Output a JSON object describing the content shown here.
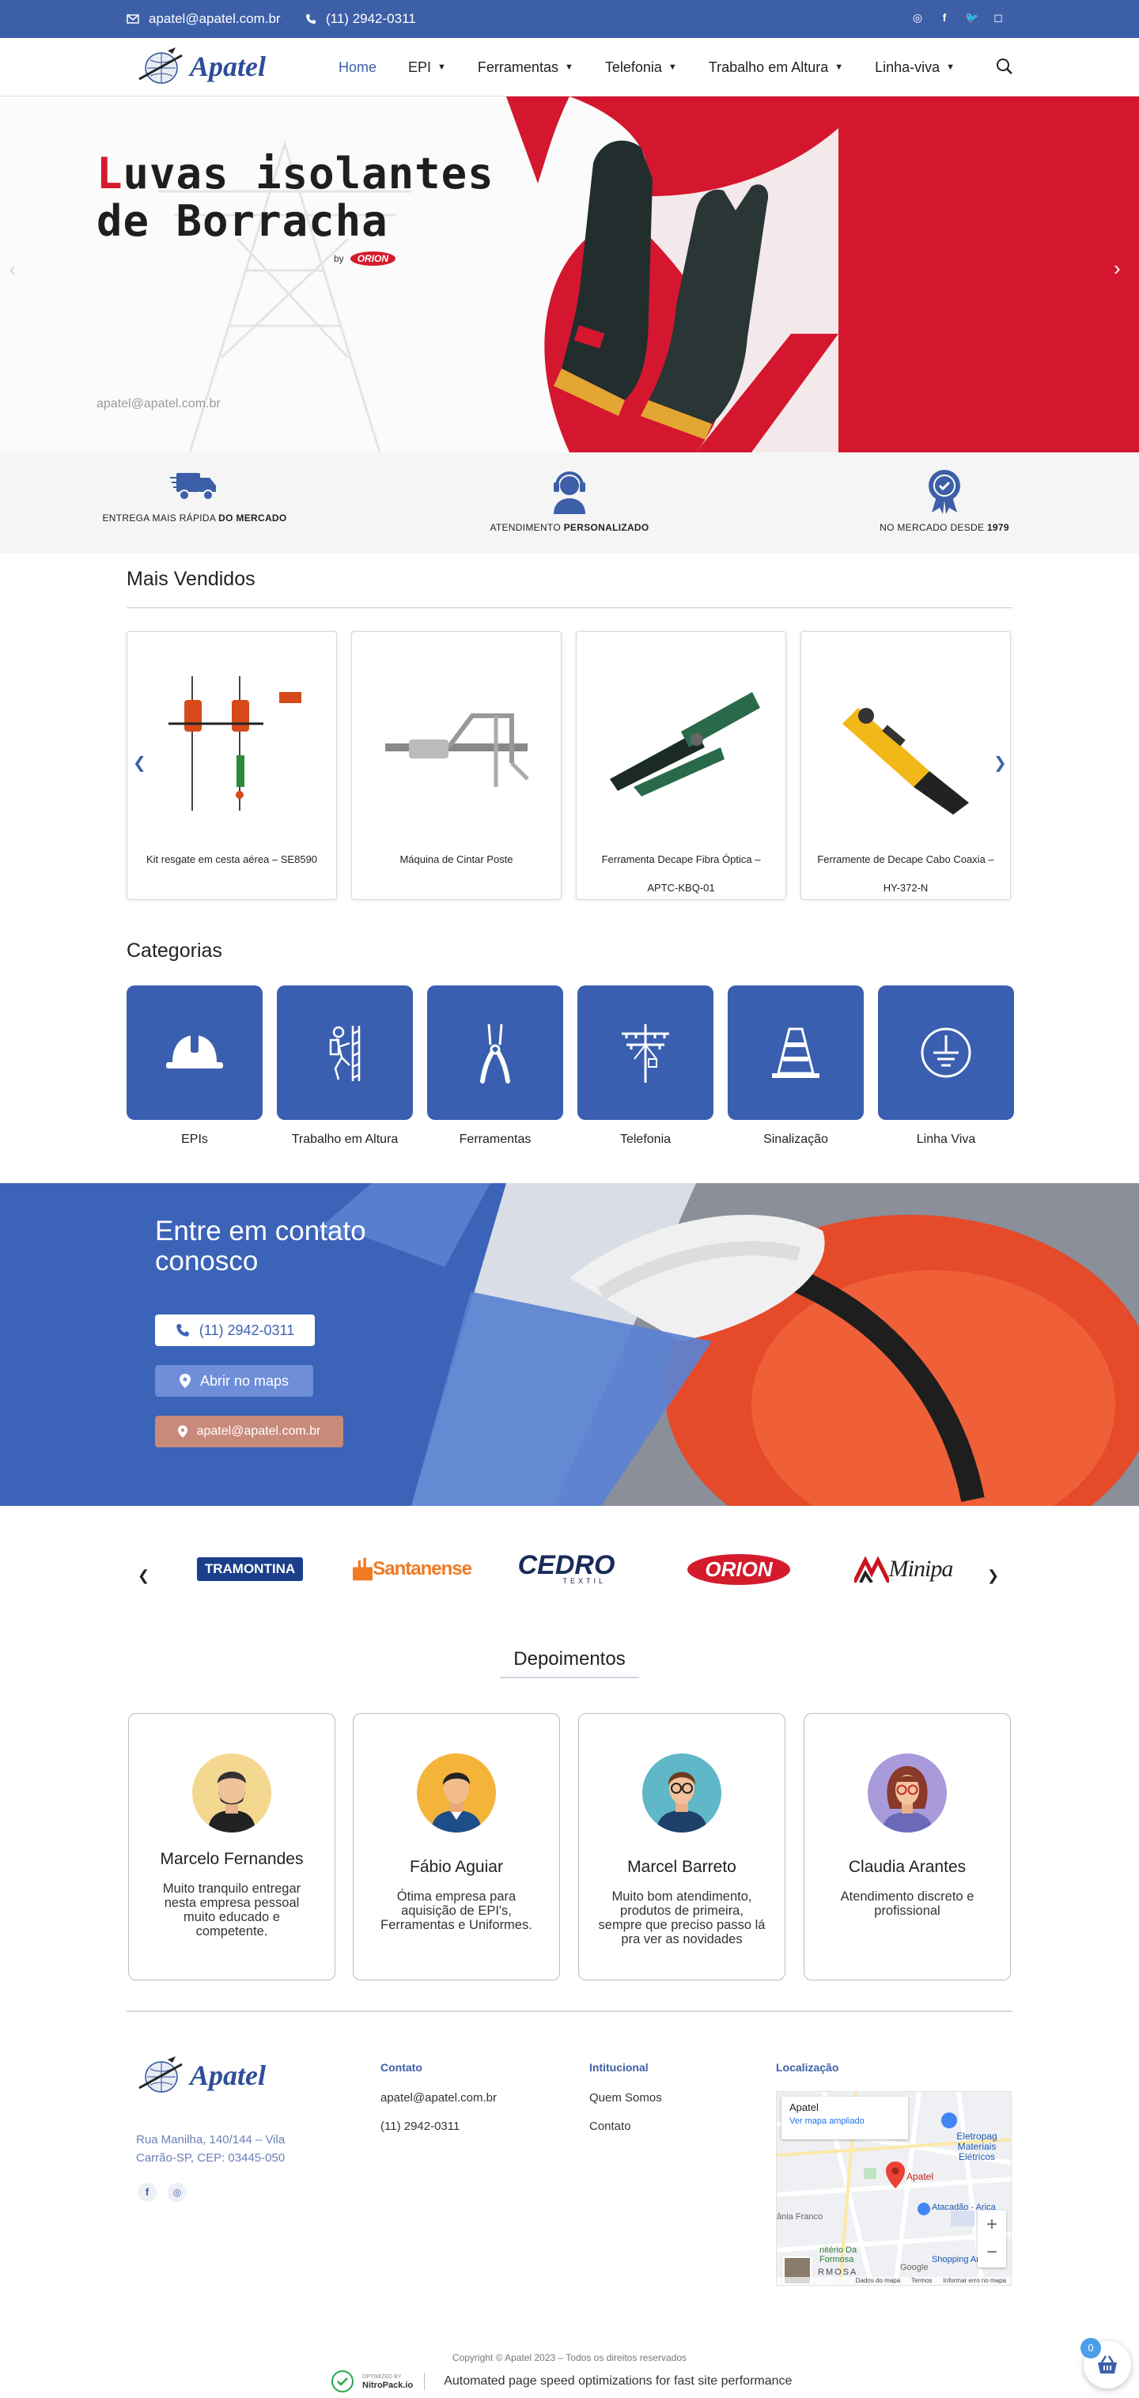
{
  "topbar": {
    "email": "apatel@apatel.com.br",
    "phone": "(11) 2942-0311",
    "social_icons": [
      "whatsapp-icon",
      "facebook-icon",
      "twitter-icon",
      "instagram-icon"
    ]
  },
  "brand": {
    "name": "Apatel",
    "color": "#3d5fa8"
  },
  "nav": {
    "items": [
      {
        "label": "Home",
        "active": true
      },
      {
        "label": "EPI"
      },
      {
        "label": "Ferramentas"
      },
      {
        "label": "Telefonia"
      },
      {
        "label": "Trabalho em Altura"
      },
      {
        "label": "Linha-viva"
      }
    ]
  },
  "hero": {
    "title_first": "L",
    "title_rest_line1": "uvas isolantes",
    "title_line2": "de Borracha",
    "by": "by",
    "by_brand": "ORION",
    "email": "apatel@apatel.com.br"
  },
  "features": [
    {
      "text_plain": "ENTREGA MAIS RÁPIDA ",
      "text_bold": "DO MERCADO"
    },
    {
      "text_plain": "ATENDIMENTO ",
      "text_bold": "PERSONALIZADO"
    },
    {
      "text_plain": "NO MERCADO DESDE ",
      "text_bold": "1979"
    }
  ],
  "bestsellers": {
    "title": "Mais Vendidos",
    "products": [
      {
        "name": "Kit resgate em cesta aérea – SE8590"
      },
      {
        "name": "Máquina de Cintar Poste"
      },
      {
        "name": "Ferramenta Decape Fibra Óptica –",
        "name2": "APTC-KBQ-01"
      },
      {
        "name": "Ferramente de Decape Cabo Coaxia –",
        "name2": "HY-372-N"
      }
    ]
  },
  "categories": {
    "title": "Categorias",
    "items": [
      {
        "label": "EPIs"
      },
      {
        "label": "Trabalho em Altura"
      },
      {
        "label": "Ferramentas"
      },
      {
        "label": "Telefonia"
      },
      {
        "label": "Sinalização"
      },
      {
        "label": "Linha Viva"
      }
    ]
  },
  "contact": {
    "title_line1": "Entre em contato",
    "title_line2": "conosco",
    "phone_btn": "(11) 2942-0311",
    "maps_btn": "Abrir no maps",
    "email_btn": "apatel@apatel.com.br"
  },
  "brands": [
    "TRAMONTINA",
    "Santanense",
    "CEDRO",
    "TEXTIL",
    "ORION",
    "Minipa"
  ],
  "testimonials": {
    "title": "Depoimentos",
    "items": [
      {
        "name": "Marcelo Fernandes",
        "text": "Muito tranquilo entregar nesta empresa pessoal muito educado e competente."
      },
      {
        "name": "Fábio Aguiar",
        "text": "Ótima empresa para aquisição de EPI's, Ferramentas e Uniformes."
      },
      {
        "name": "Marcel Barreto",
        "text": "Muito bom atendimento, produtos de primeira, sempre que preciso passo lá pra ver as novidades"
      },
      {
        "name": "Claudia Arantes",
        "text": "Atendimento discreto e profissional"
      }
    ]
  },
  "footer": {
    "address_line1": "Rua Manilha, 140/144 – Vila",
    "address_line2": "Carrão-SP, CEP: 03445-050",
    "contact_title": "Contato",
    "contact_email": "apatel@apatel.com.br",
    "contact_phone": "(11) 2942-0311",
    "inst_title": "Intitucional",
    "inst_links": [
      "Quem Somos",
      "Contato"
    ],
    "loc_title": "Localização",
    "map": {
      "place": "Apatel",
      "link": "Ver mapa ampliado",
      "labels": [
        "Eletropag",
        "Materiais Elétricos",
        "Apatel",
        "Atacadão - Arica",
        "ânia Franco",
        "nitério Da",
        "Formosa",
        "Shopping Aricand",
        "RMOSA",
        "Google"
      ],
      "footer": [
        "Dados do mapa",
        "Termos",
        "Informar erro no mapa"
      ],
      "zoom_in": "+",
      "zoom_out": "−"
    },
    "copyright": "Copyright © Apatel 2023 – Todos os direitos reservados",
    "nitro_small1": "OPTIMIZED BY",
    "nitro_small2": "NitroPack.io",
    "nitro_text": "Automated page speed optimizations for fast site performance",
    "cart_count": "0"
  }
}
